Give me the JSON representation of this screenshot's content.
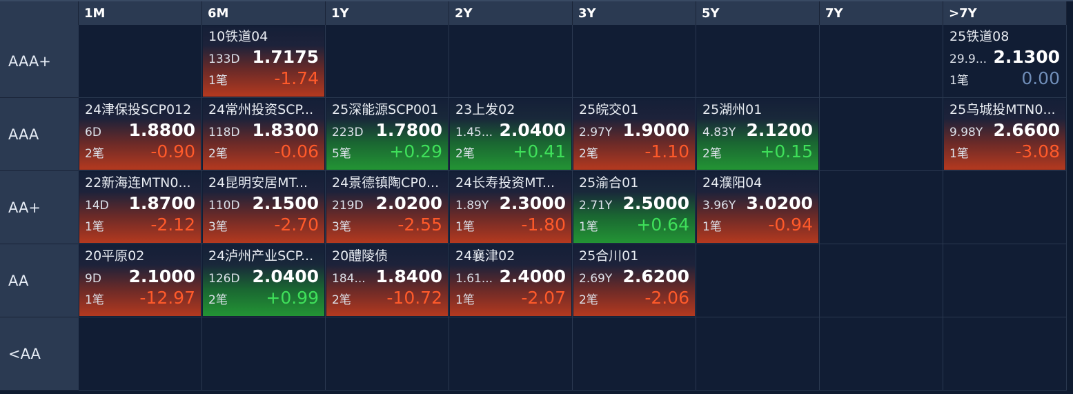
{
  "columns": [
    "1M",
    "6M",
    "1Y",
    "2Y",
    "3Y",
    "5Y",
    "7Y",
    ">7Y"
  ],
  "rows": [
    "AAA+",
    "AAA",
    "AA+",
    "AA",
    "<AA"
  ],
  "colors": {
    "negative": "#ff5a2a",
    "positive": "#3fe05a",
    "flat": "#6f8db8",
    "header_bg": "#2b3a52",
    "page_bg": "#0f1b30"
  },
  "cards": [
    {
      "row": 0,
      "col": 1,
      "name": "10铁道04",
      "term": "133D",
      "yield": "1.7175",
      "count": "1笔",
      "change": "-1.74",
      "dir": "neg"
    },
    {
      "row": 0,
      "col": 7,
      "name": "25铁道08",
      "term": "29.9...",
      "yield": "2.1300",
      "count": "1笔",
      "change": "0.00",
      "dir": "flat"
    },
    {
      "row": 1,
      "col": 0,
      "name": "24津保投SCP012",
      "term": "6D",
      "yield": "1.8800",
      "count": "2笔",
      "change": "-0.90",
      "dir": "neg"
    },
    {
      "row": 1,
      "col": 1,
      "name": "24常州投资SCP...",
      "term": "118D",
      "yield": "1.8300",
      "count": "2笔",
      "change": "-0.06",
      "dir": "neg"
    },
    {
      "row": 1,
      "col": 2,
      "name": "25深能源SCP001",
      "term": "223D",
      "yield": "1.7800",
      "count": "5笔",
      "change": "+0.29",
      "dir": "pos"
    },
    {
      "row": 1,
      "col": 3,
      "name": "23上发02",
      "term": "1.45...",
      "yield": "2.0400",
      "count": "2笔",
      "change": "+0.41",
      "dir": "pos"
    },
    {
      "row": 1,
      "col": 4,
      "name": "25皖交01",
      "term": "2.97Y",
      "yield": "1.9000",
      "count": "2笔",
      "change": "-1.10",
      "dir": "neg"
    },
    {
      "row": 1,
      "col": 5,
      "name": "25湖州01",
      "term": "4.83Y",
      "yield": "2.1200",
      "count": "2笔",
      "change": "+0.15",
      "dir": "pos"
    },
    {
      "row": 1,
      "col": 7,
      "name": "25乌城投MTN0...",
      "term": "9.98Y",
      "yield": "2.6600",
      "count": "1笔",
      "change": "-3.08",
      "dir": "neg"
    },
    {
      "row": 2,
      "col": 0,
      "name": "22新海连MTN0...",
      "term": "14D",
      "yield": "1.8700",
      "count": "1笔",
      "change": "-2.12",
      "dir": "neg"
    },
    {
      "row": 2,
      "col": 1,
      "name": "24昆明安居MT...",
      "term": "110D",
      "yield": "2.1500",
      "count": "3笔",
      "change": "-2.70",
      "dir": "neg"
    },
    {
      "row": 2,
      "col": 2,
      "name": "24景德镇陶CP0...",
      "term": "219D",
      "yield": "2.0200",
      "count": "3笔",
      "change": "-2.55",
      "dir": "neg"
    },
    {
      "row": 2,
      "col": 3,
      "name": "24长寿投资MT...",
      "term": "1.89Y",
      "yield": "2.3000",
      "count": "1笔",
      "change": "-1.80",
      "dir": "neg"
    },
    {
      "row": 2,
      "col": 4,
      "name": "25渝合01",
      "term": "2.71Y",
      "yield": "2.5000",
      "count": "1笔",
      "change": "+0.64",
      "dir": "pos"
    },
    {
      "row": 2,
      "col": 5,
      "name": "24濮阳04",
      "term": "3.96Y",
      "yield": "3.0200",
      "count": "1笔",
      "change": "-0.94",
      "dir": "neg"
    },
    {
      "row": 3,
      "col": 0,
      "name": "20平原02",
      "term": "9D",
      "yield": "2.1000",
      "count": "1笔",
      "change": "-12.97",
      "dir": "neg"
    },
    {
      "row": 3,
      "col": 1,
      "name": "24泸州产业SCP...",
      "term": "126D",
      "yield": "2.0400",
      "count": "2笔",
      "change": "+0.99",
      "dir": "pos"
    },
    {
      "row": 3,
      "col": 2,
      "name": "20醴陵债",
      "term": "184...",
      "yield": "1.8400",
      "count": "2笔",
      "change": "-10.72",
      "dir": "neg"
    },
    {
      "row": 3,
      "col": 3,
      "name": "24襄津02",
      "term": "1.61...",
      "yield": "2.4000",
      "count": "1笔",
      "change": "-2.07",
      "dir": "neg"
    },
    {
      "row": 3,
      "col": 4,
      "name": "25合川01",
      "term": "2.69Y",
      "yield": "2.6200",
      "count": "2笔",
      "change": "-2.06",
      "dir": "neg"
    }
  ]
}
